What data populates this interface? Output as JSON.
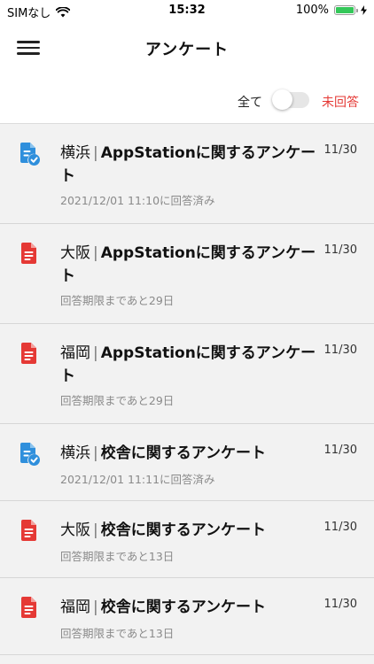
{
  "status_bar": {
    "carrier": "SIMなし",
    "time": "15:32",
    "battery": "100%",
    "battery_level": 1.0
  },
  "nav": {
    "title": "アンケート",
    "menu_icon": "hamburger-menu-icon"
  },
  "filter": {
    "all_label": "全て",
    "unanswered_label": "未回答",
    "toggle_on": false,
    "accent_color": "#e53935"
  },
  "colors": {
    "answered_icon": "#2f8fdc",
    "unanswered_icon": "#e53935"
  },
  "surveys": [
    {
      "place": "横浜",
      "name": "AppStationに関するアンケート",
      "date": "11/30",
      "status": "2021/12/01 11:10に回答済み",
      "answered": true,
      "icon": "answered-document-icon"
    },
    {
      "place": "大阪",
      "name": "AppStationに関するアンケート",
      "date": "11/30",
      "status": "回答期限まであと29日",
      "answered": false,
      "icon": "document-icon"
    },
    {
      "place": "福岡",
      "name": "AppStationに関するアンケート",
      "date": "11/30",
      "status": "回答期限まであと29日",
      "answered": false,
      "icon": "document-icon"
    },
    {
      "place": "横浜",
      "name": "校舎に関するアンケート",
      "date": "11/30",
      "status": "2021/12/01 11:11に回答済み",
      "answered": true,
      "icon": "answered-document-icon"
    },
    {
      "place": "大阪",
      "name": "校舎に関するアンケート",
      "date": "11/30",
      "status": "回答期限まであと13日",
      "answered": false,
      "icon": "document-icon"
    },
    {
      "place": "福岡",
      "name": "校舎に関するアンケート",
      "date": "11/30",
      "status": "回答期限まであと13日",
      "answered": false,
      "icon": "document-icon"
    }
  ]
}
